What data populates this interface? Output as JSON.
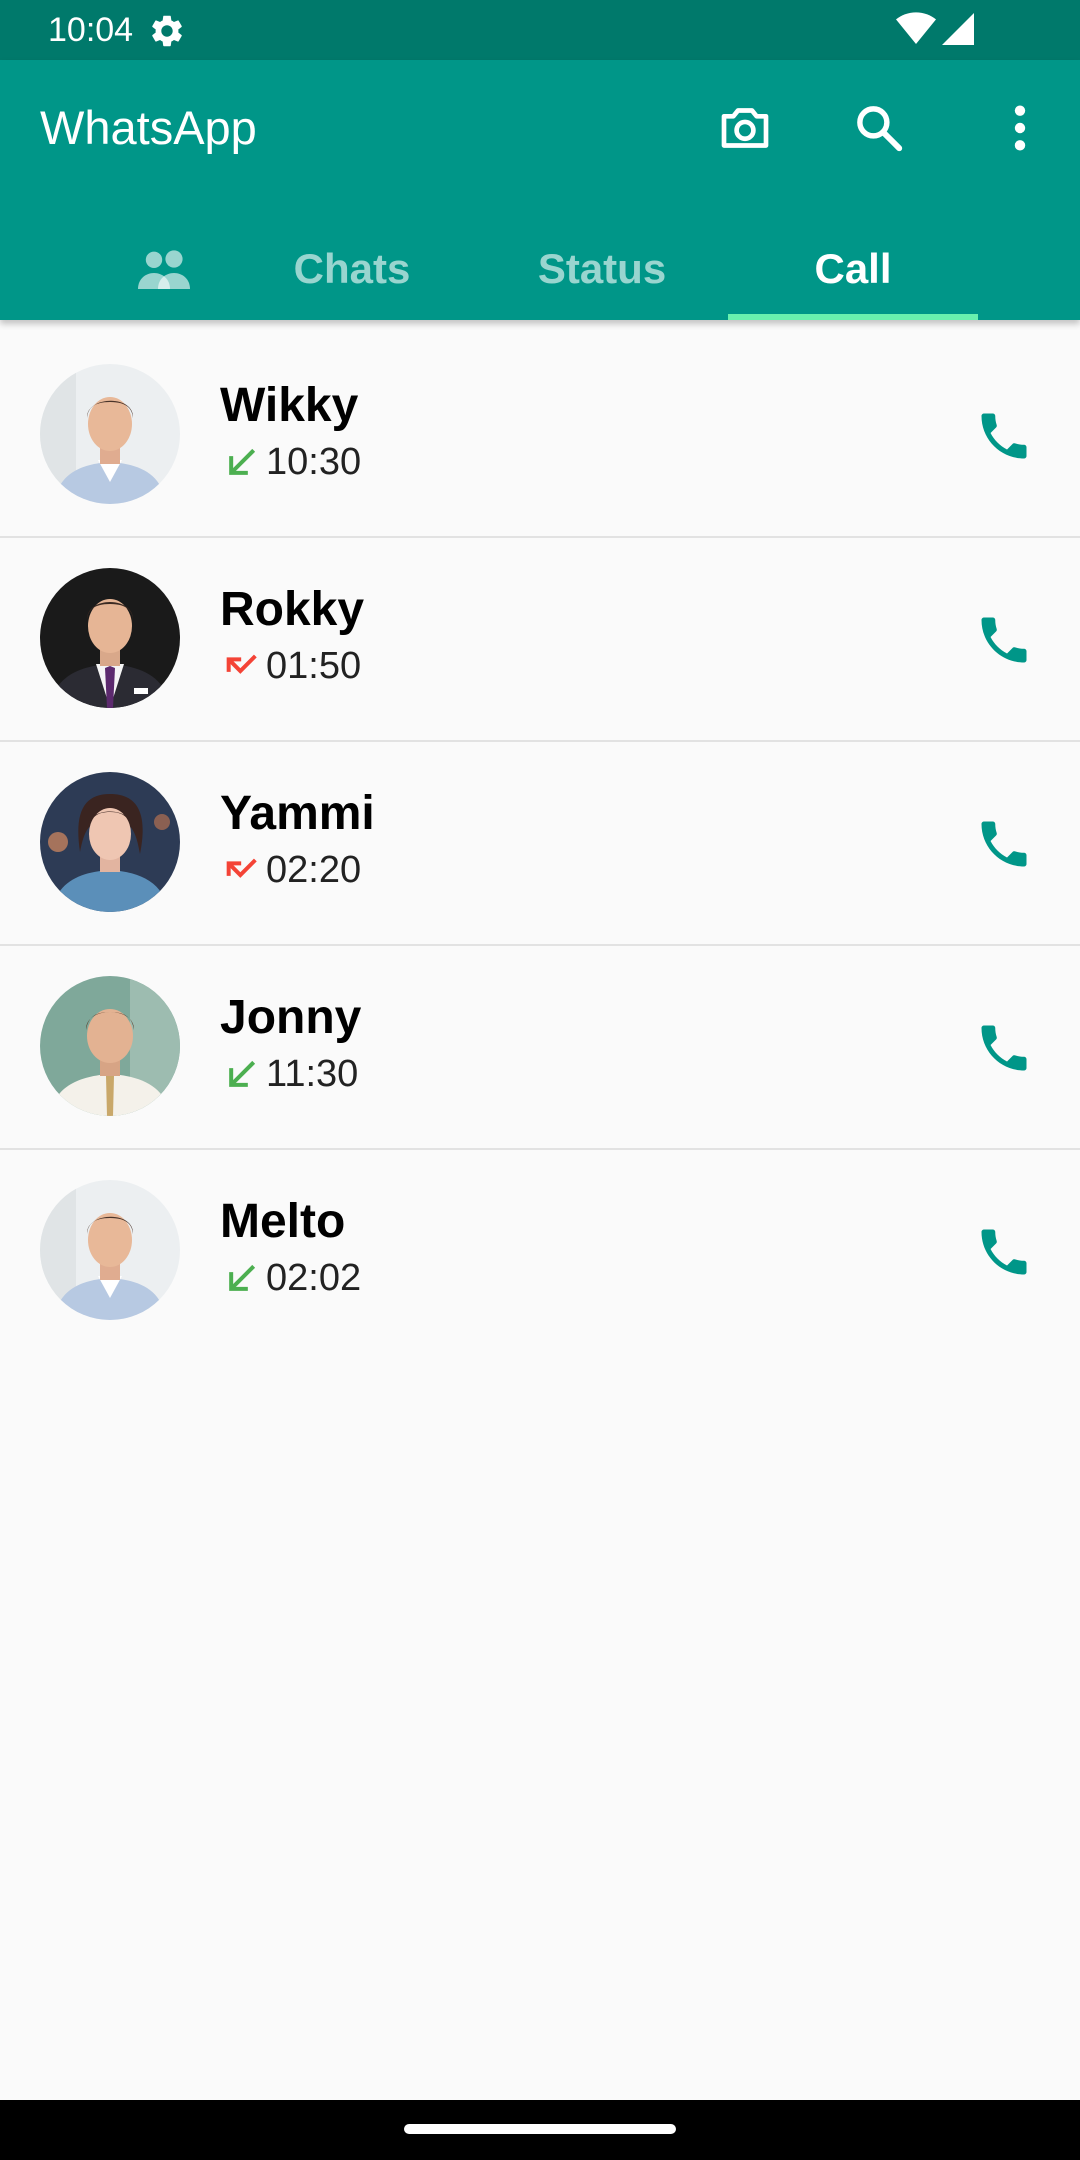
{
  "status_bar": {
    "time": "10:04",
    "icons": [
      "settings-gear-icon",
      "wifi-icon",
      "cell-signal-icon"
    ]
  },
  "app_bar": {
    "title": "WhatsApp",
    "actions": [
      "camera-icon",
      "search-icon",
      "more-vert-icon"
    ]
  },
  "tabs": [
    {
      "icon": "groups-icon",
      "label": ""
    },
    {
      "label": "Chats"
    },
    {
      "label": "Status"
    },
    {
      "label": "Call",
      "selected": true
    }
  ],
  "calls": [
    {
      "name": "Wikky",
      "time": "10:30",
      "direction": "received",
      "action": "call-icon"
    },
    {
      "name": "Rokky",
      "time": "01:50",
      "direction": "missed",
      "action": "call-icon"
    },
    {
      "name": "Yammi",
      "time": "02:20",
      "direction": "missed",
      "action": "call-icon"
    },
    {
      "name": "Jonny",
      "time": "11:30",
      "direction": "received",
      "action": "call-icon"
    },
    {
      "name": "Melto",
      "time": "02:02",
      "direction": "received",
      "action": "call-icon"
    }
  ],
  "colors": {
    "status_bar": "#00796b",
    "app_bar": "#009688",
    "tab_indicator": "#69f0ae",
    "call_icon": "#009688",
    "received_arrow": "#4caf50",
    "missed_arrow": "#f44336",
    "background": "#fafafa"
  }
}
